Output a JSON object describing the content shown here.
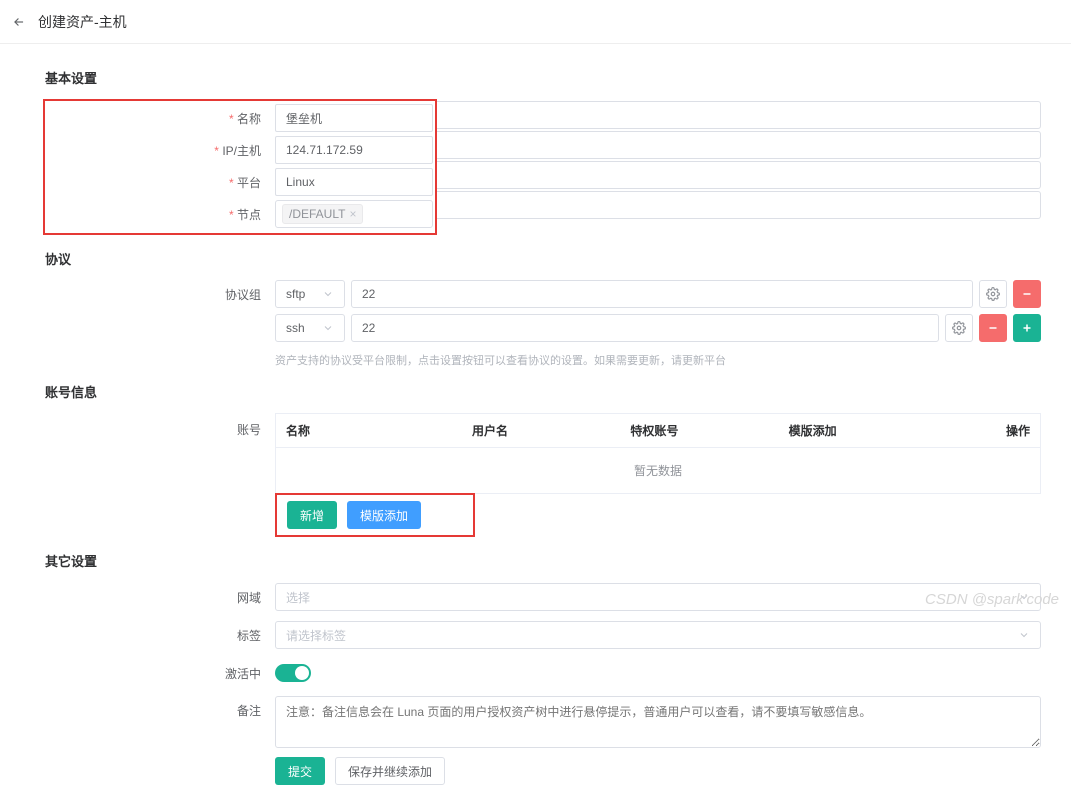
{
  "header": {
    "title": "创建资产-主机"
  },
  "sections": {
    "basic": {
      "title": "基本设置",
      "name_label": "名称",
      "name_value": "堡垒机",
      "ip_label": "IP/主机",
      "ip_value": "124.71.172.59",
      "platform_label": "平台",
      "platform_value": "Linux",
      "node_label": "节点",
      "node_tag": "/DEFAULT"
    },
    "protocol": {
      "title": "协议",
      "group_label": "协议组",
      "rows": [
        {
          "proto": "sftp",
          "port": "22"
        },
        {
          "proto": "ssh",
          "port": "22"
        }
      ],
      "hint": "资产支持的协议受平台限制，点击设置按钮可以查看协议的设置。如果需要更新，请更新平台"
    },
    "account": {
      "title": "账号信息",
      "label": "账号",
      "cols": {
        "name": "名称",
        "user": "用户名",
        "priv": "特权账号",
        "tmpl": "模版添加",
        "op": "操作"
      },
      "empty": "暂无数据",
      "add_btn": "新增",
      "template_btn": "模版添加"
    },
    "other": {
      "title": "其它设置",
      "domain_label": "网域",
      "domain_placeholder": "选择",
      "tags_label": "标签",
      "tags_placeholder": "请选择标签",
      "active_label": "激活中",
      "remark_label": "备注",
      "remark_placeholder": "注意：备注信息会在 Luna 页面的用户授权资产树中进行悬停提示，普通用户可以查看，请不要填写敏感信息。",
      "submit": "提交",
      "save_continue": "保存并继续添加"
    }
  },
  "watermark": "CSDN @spark'code"
}
